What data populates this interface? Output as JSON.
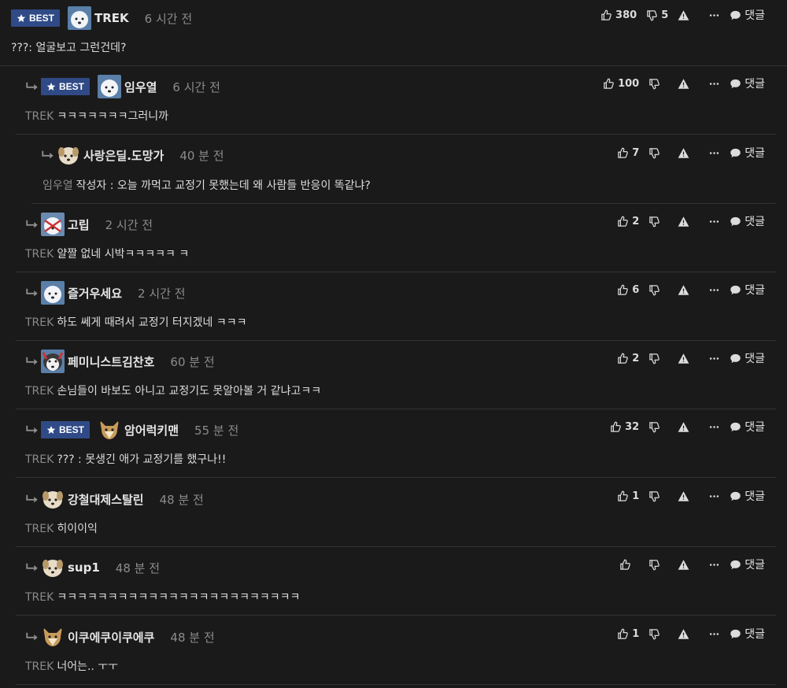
{
  "comments": [
    {
      "best": true,
      "best_label": "BEST",
      "nick": "TREK",
      "time": "6 시간 전",
      "mention": "",
      "text": "???: 얼굴보고 그런건데?",
      "likes": "380",
      "dislikes": "5",
      "reply": "댓글"
    },
    {
      "best": true,
      "best_label": "BEST",
      "nick": "임우열",
      "time": "6 시간 전",
      "mention": "TREK",
      "text": "ㅋㅋㅋㅋㅋㅋㅋ그러니까",
      "likes": "100",
      "dislikes": "",
      "reply": "댓글"
    },
    {
      "best": false,
      "nick": "사랑은딜.도망가",
      "time": "40 분 전",
      "mention": "임우열",
      "text": "작성자 : 오늘 까먹고 교정기 못했는데 왜 사람들 반응이 똑같냐?",
      "likes": "7",
      "dislikes": "",
      "reply": "댓글"
    },
    {
      "best": false,
      "nick": "고립",
      "time": "2 시간 전",
      "mention": "TREK",
      "text": "얄짤 없네 시박ㅋㅋㅋㅋㅋ ㅋ",
      "likes": "2",
      "dislikes": "",
      "reply": "댓글"
    },
    {
      "best": false,
      "nick": "즐거우세요",
      "time": "2 시간 전",
      "mention": "TREK",
      "text": "하도 쎄게 때려서 교정기 터지겠네 ㅋㅋㅋ",
      "likes": "6",
      "dislikes": "",
      "reply": "댓글"
    },
    {
      "best": false,
      "nick": "페미니스트김찬호",
      "time": "60 분 전",
      "mention": "TREK",
      "text": "손님들이 바보도 아니고 교정기도 못알아볼 거 같냐고ㅋㅋ",
      "likes": "2",
      "dislikes": "",
      "reply": "댓글"
    },
    {
      "best": true,
      "best_label": "BEST",
      "nick": "암어럭키맨",
      "time": "55 분 전",
      "mention": "TREK",
      "text": "??? : 못생긴 애가 교정기를 했구나!!",
      "likes": "32",
      "dislikes": "",
      "reply": "댓글"
    },
    {
      "best": false,
      "nick": "강철대제스탈린",
      "time": "48 분 전",
      "mention": "TREK",
      "text": "히이이익",
      "likes": "1",
      "dislikes": "",
      "reply": "댓글"
    },
    {
      "best": false,
      "nick": "sup1",
      "time": "48 분 전",
      "mention": "TREK",
      "text": "ㅋㅋㅋㅋㅋㅋㅋㅋㅋㅋㅋㅋㅋㅋㅋㅋㅋㅋㅋㅋㅋㅋㅋㅋ",
      "likes": "",
      "dislikes": "",
      "reply": "댓글"
    },
    {
      "best": false,
      "nick": "이쿠에쿠이쿠에쿠",
      "time": "48 분 전",
      "mention": "TREK",
      "text": "너어는.. ㅜㅜ",
      "likes": "1",
      "dislikes": "",
      "reply": "댓글"
    }
  ],
  "colors": {
    "background": "#1a1a1a",
    "best_badge": "#2f4a86",
    "divider": "#333333"
  },
  "icons": [
    "reply-arrow-icon",
    "star-icon",
    "thumbs-up-icon",
    "thumbs-down-icon",
    "warning-icon",
    "more-icon",
    "speech-bubble-icon"
  ]
}
